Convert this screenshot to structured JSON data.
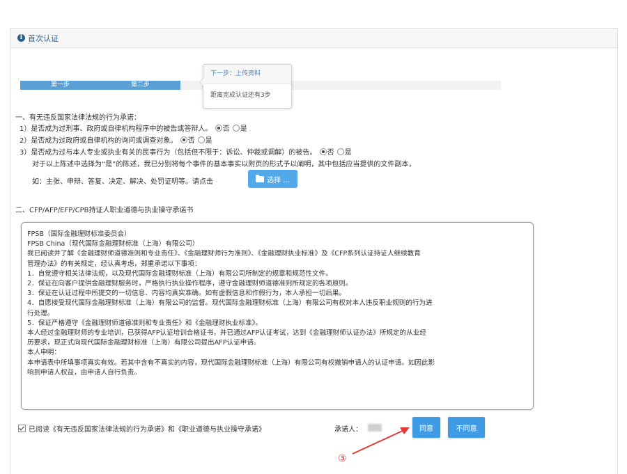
{
  "header": {
    "title": "首次认证",
    "icon": "info-icon"
  },
  "progress": {
    "steps": [
      "第一步",
      "第二步"
    ],
    "popover_title": "下一步：上传资料",
    "popover_body": "距离完成认证还有3步"
  },
  "section1": {
    "title": "一、有无违反国家法律法规的行为承诺：",
    "q1": "1）是否成为过刑事、政府或自律机构程序中的被告或答辩人。",
    "q2": "2）是否成为过政府或自律机构的询问或调查对象。",
    "q3": "3）是否成为过与本人专业或执业有关的民事行为（包括但不限于：诉讼、仲裁或调解）的被告。",
    "opt_no": "否",
    "opt_yes": "是",
    "note1": "对于以上陈述中选择为“是”的陈述，我已分别将每个事件的基本事实以附页的形式予以阐明，其中包括应当提供的文件副本，",
    "note2": "如：主张、申辩、答复、决定、解决、处罚证明等。请点击",
    "choose_btn": "选择 ..."
  },
  "section2": {
    "title": "二、CFP/AFP/EFP/CPB持证人职业道德与执业操守承诺书",
    "lines": [
      "FPSB（国际金融理财标准委员会）",
      "FPSB China（现代国际金融理财标准（上海）有限公司）",
      "我已阅读并了解《金融理财师道德准则和专业责任》、《金融理财师行为准则》、《金融理财执业标准》及《CFP系列认证持证人继续教育",
      "管理办法》的有关规定，经认真考虑，郑重承诺以下事项：",
      "1．自觉遵守相关法律法规，以及现代国际金融理财标准（上海）有限公司所制定的规章和规范性文件。",
      "2．保证在向客户提供金融理财服务时，严格执行执业操作程序，遵守金融理财师道德准则所规定的各项原则。",
      "3．保证在认证过程中所提交的一切信息、内容均真实准确。如有虚假信息和作假行为，本人承担一切后果。",
      "4．自愿接受现代国际金融理财标准（上海）有限公司的监督。现代国际金融理财标准（上海）有限公司有权对本人违反职业规则的行为进",
      "行处理。",
      "5．保证严格遵守《金融理财师道德准则和专业责任》和《金融理财执业标准》。",
      "本人经过金融理财师的专业培训，已获得AFP认证培训合格证书，并已通过AFP认证考试，达到《金融理财师认证办法》所规定的从业经",
      "历要求，现正式向现代国际金融理财标准（上海）有限公司提出AFP认证申请。",
      "本人申明：",
      "本申请表中所填事项真实有效。若其中含有不真实的内容，现代国际金融理财标准（上海）有限公司有权撤销申请人的认证申请。如因此影",
      "响到申请人权益，由申请人自行负责。"
    ]
  },
  "footer": {
    "check_label": "已阅读《有无违反国家法律法规的行为承诺》和《职业道德与执业操守承诺》",
    "pledger_label": "承诺人：",
    "agree": "同意",
    "disagree": "不同意",
    "step_marker": "③"
  },
  "colors": {
    "accent": "#3f9ce4",
    "arrow": "#e23a3a",
    "progress": "#5a9fd6"
  }
}
